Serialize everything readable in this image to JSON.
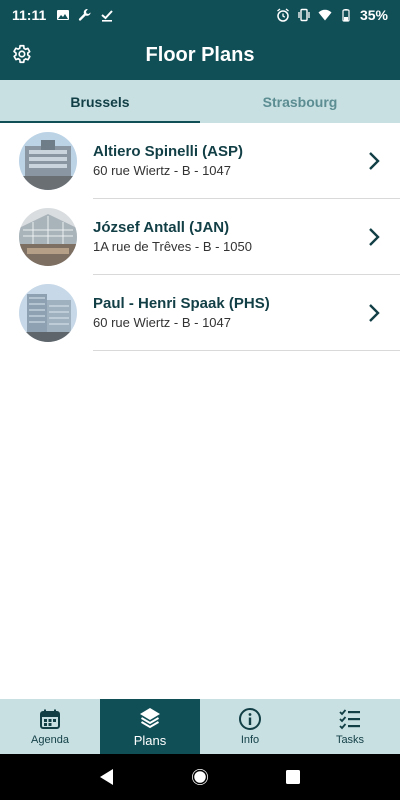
{
  "status_bar": {
    "time": "11:11",
    "battery": "35%"
  },
  "app_bar": {
    "title": "Floor Plans",
    "settings_icon": "gear-icon"
  },
  "tabs": [
    {
      "label": "Brussels",
      "active": true
    },
    {
      "label": "Strasbourg",
      "active": false
    }
  ],
  "buildings": [
    {
      "name": "Altiero Spinelli (ASP)",
      "address": "60 rue Wiertz - B - 1047"
    },
    {
      "name": "József Antall (JAN)",
      "address": "1A rue de Trêves - B - 1050"
    },
    {
      "name": "Paul - Henri Spaak (PHS)",
      "address": "60 rue Wiertz - B - 1047"
    }
  ],
  "bottom_nav": [
    {
      "label": "Agenda",
      "icon": "calendar-icon",
      "active": false
    },
    {
      "label": "Plans",
      "icon": "layers-icon",
      "active": true
    },
    {
      "label": "Info",
      "icon": "info-icon",
      "active": false
    },
    {
      "label": "Tasks",
      "icon": "checklist-icon",
      "active": false
    }
  ],
  "colors": {
    "primary": "#114f57",
    "tab_background": "#c8e0e2",
    "title_text": "#123f46"
  }
}
